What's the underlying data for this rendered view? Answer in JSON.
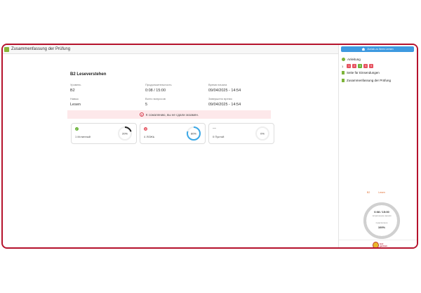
{
  "window_title": "Zusammenfassung der Prüfung",
  "exam": {
    "title": "B2 Leseverstehen",
    "fields": [
      {
        "label": "Уровень",
        "value": "B2"
      },
      {
        "label": "Продолжительность",
        "value": "0:08 / 15:00"
      },
      {
        "label": "Время начала",
        "value": "09/04/2025 - 14:54"
      },
      {
        "label": "Навык",
        "value": "Lesen"
      },
      {
        "label": "Всего вопросов",
        "value": "5"
      },
      {
        "label": "Завершено время",
        "value": "09/04/2025 - 14:54"
      }
    ]
  },
  "alert": {
    "icon": "x-circle-icon",
    "text": "К сожалению, вы не сдали экзамен."
  },
  "results": [
    {
      "label": "1 Истинный",
      "percent": 20,
      "display": "20%",
      "icon": "check-icon",
      "color": "#222222",
      "icon_color": "#6bb33a"
    },
    {
      "label": "4 ЛОЖЬ",
      "percent": 80,
      "display": "80%",
      "icon": "x-icon",
      "color": "#3ba8e6",
      "icon_color": "#e5525f"
    },
    {
      "label": "0 Пустой",
      "percent": 0,
      "display": "0%",
      "icon": "dash-icon",
      "color": "#cccccc",
      "icon_color": "#888888",
      "marker": "—"
    }
  ],
  "sidebar": {
    "home_button": "Zurück zu Ihrem Lernen",
    "nav": [
      {
        "label": "Anleitung",
        "icon": "check-dot-icon"
      },
      {
        "label": "Seite für Einsendungen",
        "icon": "check-square-icon"
      },
      {
        "label": "Zusammenfassung der Prüfung",
        "icon": "check-square-icon"
      }
    ],
    "page_label": "1",
    "pages": [
      "1",
      "2",
      "3",
      "4",
      "5"
    ],
    "page_colors": [
      "#e5525f",
      "#e5525f",
      "#6bb33a",
      "#e5525f",
      "#e5525f"
    ],
    "level": "B2",
    "skill": "Lesen",
    "time": "0:08 / 15:00",
    "time_caption": "затраченное время",
    "progress_caption": "подключено",
    "progress": "100%",
    "progress_value": 1.0,
    "logo_text": "test\ngerman"
  }
}
